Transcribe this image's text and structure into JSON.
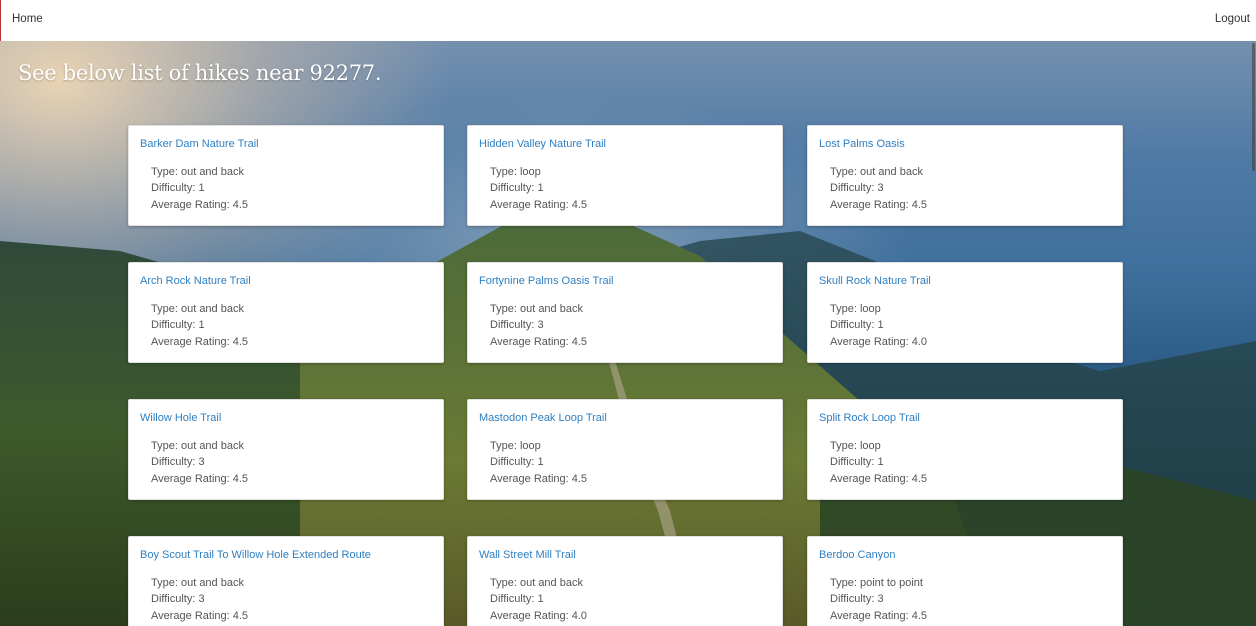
{
  "nav": {
    "home": "Home",
    "logout": "Logout"
  },
  "heading": "See below list of hikes near 92277.",
  "labels": {
    "type": "Type:",
    "difficulty": "Difficulty:",
    "rating": "Average Rating:"
  },
  "hikes": [
    {
      "name": "Barker Dam Nature Trail",
      "type": "out and back",
      "difficulty": "1",
      "rating": "4.5"
    },
    {
      "name": "Hidden Valley Nature Trail",
      "type": "loop",
      "difficulty": "1",
      "rating": "4.5"
    },
    {
      "name": "Lost Palms Oasis",
      "type": "out and back",
      "difficulty": "3",
      "rating": "4.5"
    },
    {
      "name": "Arch Rock Nature Trail",
      "type": "out and back",
      "difficulty": "1",
      "rating": "4.5"
    },
    {
      "name": "Fortynine Palms Oasis Trail",
      "type": "out and back",
      "difficulty": "3",
      "rating": "4.5"
    },
    {
      "name": "Skull Rock Nature Trail",
      "type": "loop",
      "difficulty": "1",
      "rating": "4.0"
    },
    {
      "name": "Willow Hole Trail",
      "type": "out and back",
      "difficulty": "3",
      "rating": "4.5"
    },
    {
      "name": "Mastodon Peak Loop Trail",
      "type": "loop",
      "difficulty": "1",
      "rating": "4.5"
    },
    {
      "name": "Split Rock Loop Trail",
      "type": "loop",
      "difficulty": "1",
      "rating": "4.5"
    },
    {
      "name": "Boy Scout Trail To Willow Hole Extended Route",
      "type": "out and back",
      "difficulty": "3",
      "rating": "4.5"
    },
    {
      "name": "Wall Street Mill Trail",
      "type": "out and back",
      "difficulty": "1",
      "rating": "4.0"
    },
    {
      "name": "Berdoo Canyon",
      "type": "point to point",
      "difficulty": "3",
      "rating": "4.5"
    }
  ]
}
